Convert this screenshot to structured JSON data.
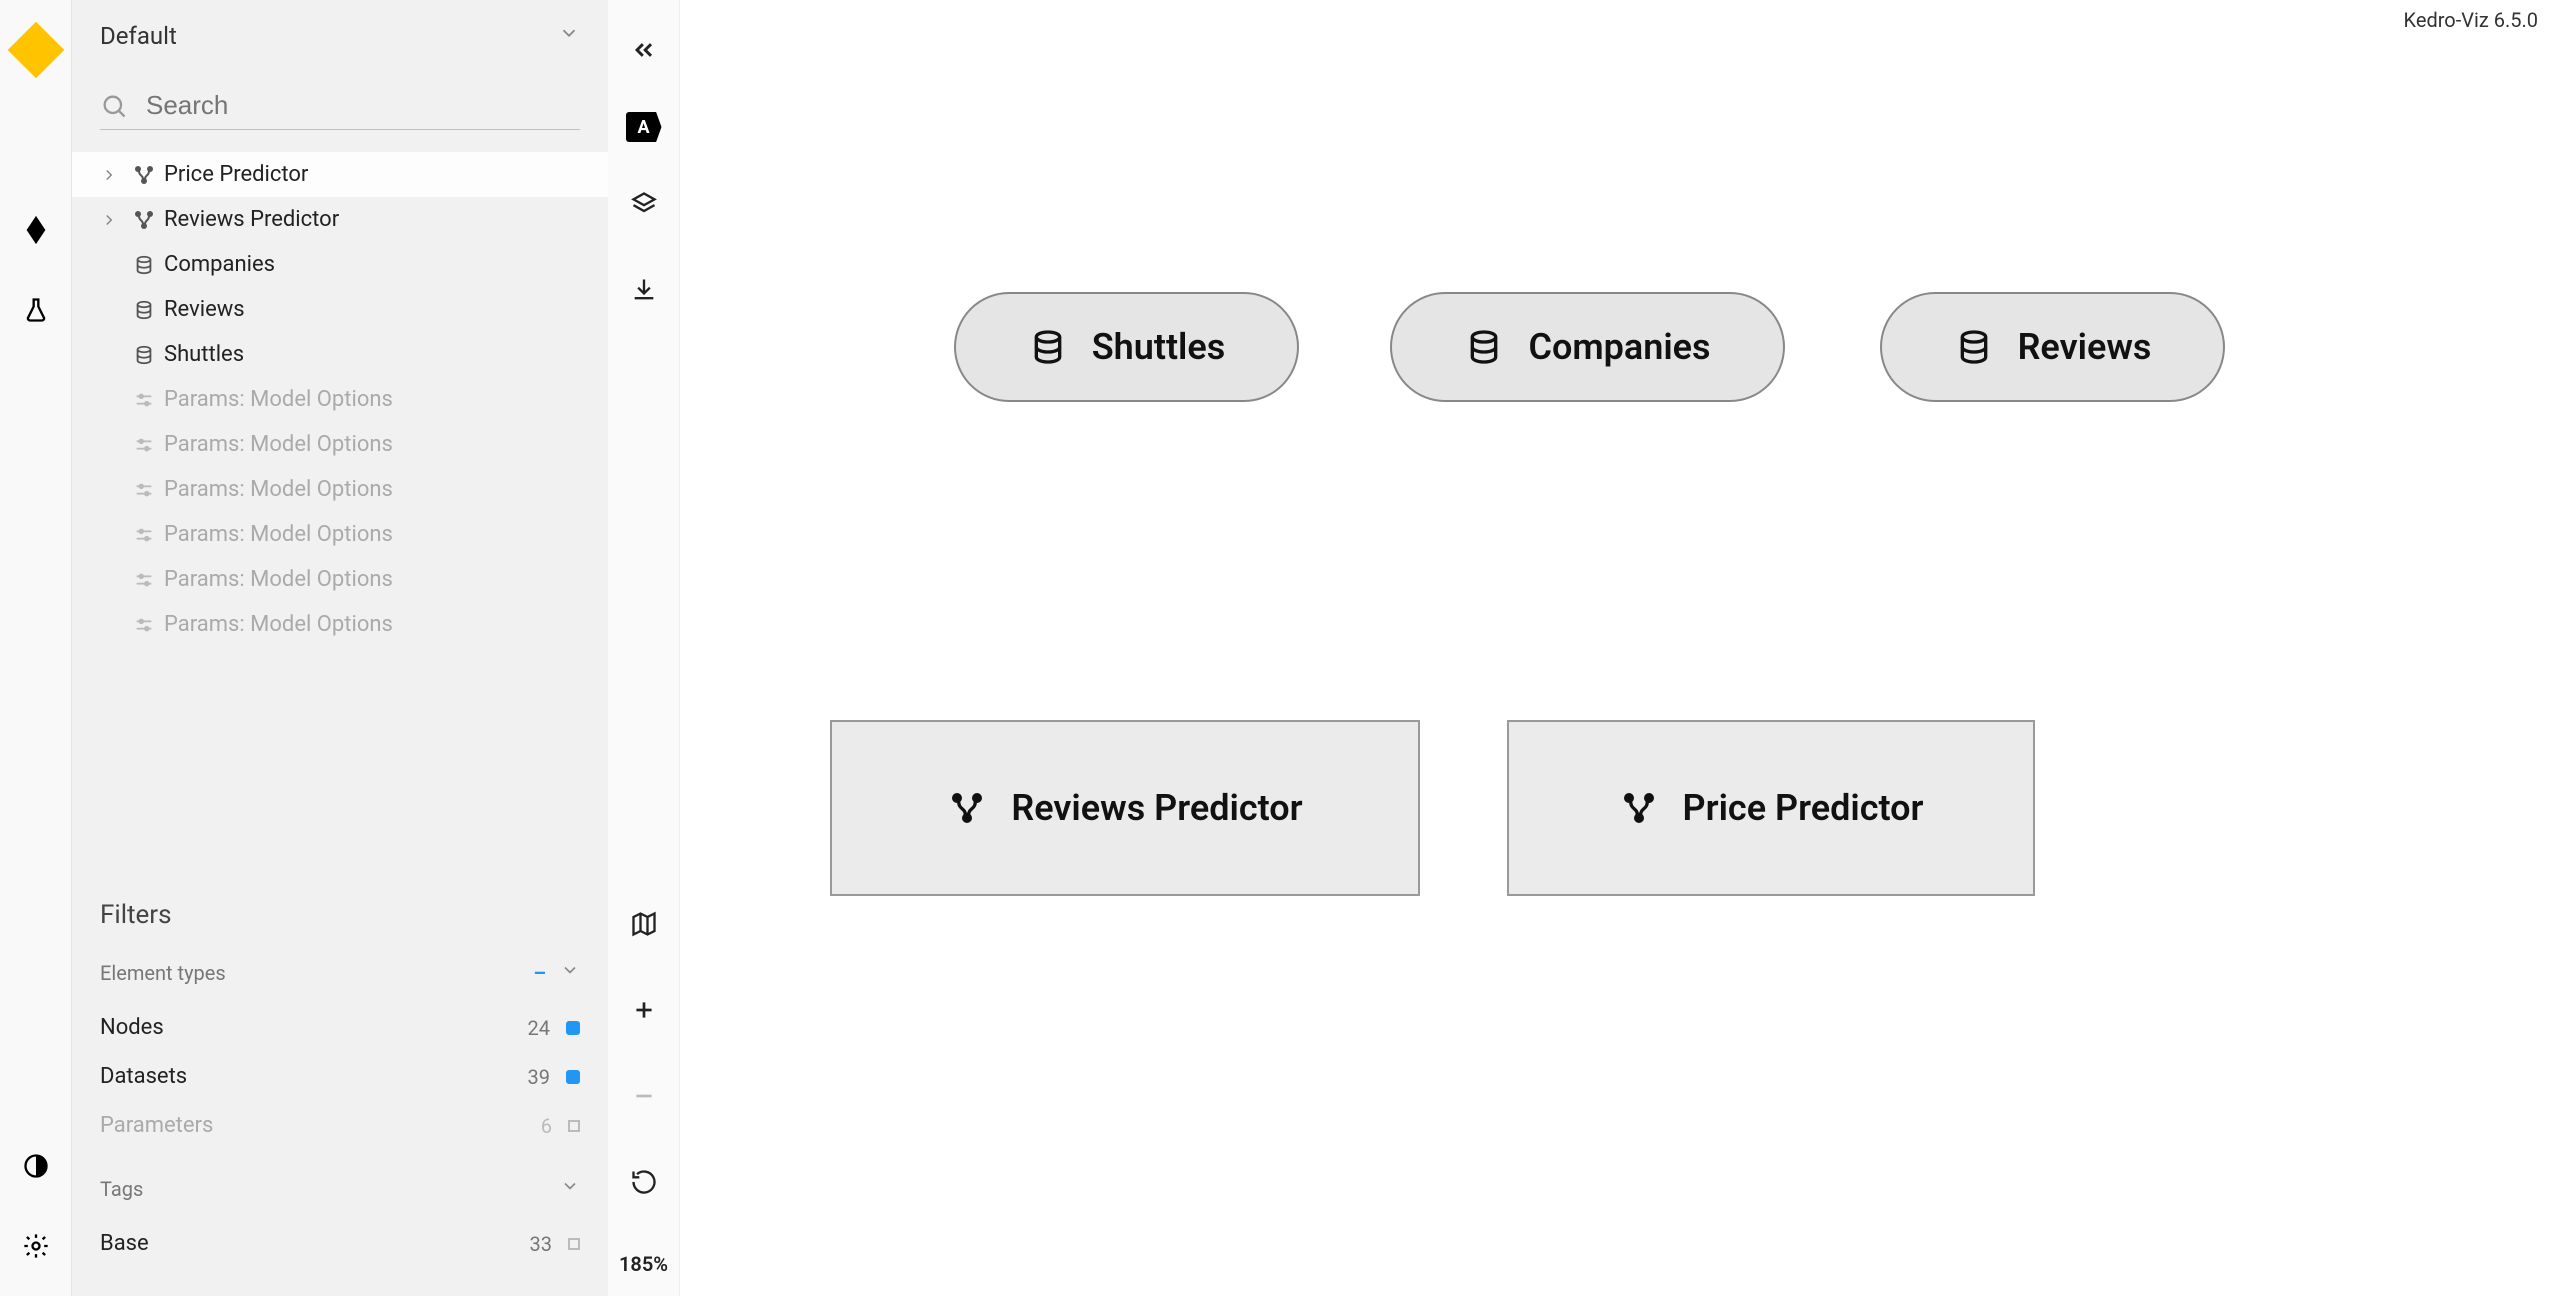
{
  "app_version": "Kedro-Viz 6.5.0",
  "pipeline_selector": {
    "label": "Default"
  },
  "search": {
    "placeholder": "Search"
  },
  "tree": {
    "items": [
      {
        "type": "pipeline",
        "label": "Price Predictor",
        "selected": true,
        "expandable": true
      },
      {
        "type": "pipeline",
        "label": "Reviews Predictor",
        "selected": false,
        "expandable": true
      },
      {
        "type": "data",
        "label": "Companies"
      },
      {
        "type": "data",
        "label": "Reviews"
      },
      {
        "type": "data",
        "label": "Shuttles"
      },
      {
        "type": "params",
        "label": "Params: Model Options",
        "dim": true
      },
      {
        "type": "params",
        "label": "Params: Model Options",
        "dim": true
      },
      {
        "type": "params",
        "label": "Params: Model Options",
        "dim": true
      },
      {
        "type": "params",
        "label": "Params: Model Options",
        "dim": true
      },
      {
        "type": "params",
        "label": "Params: Model Options",
        "dim": true
      },
      {
        "type": "params",
        "label": "Params: Model Options",
        "dim": true
      }
    ]
  },
  "filters": {
    "title": "Filters",
    "element_types_label": "Element types",
    "rows": [
      {
        "label": "Nodes",
        "count": "24",
        "checked": true
      },
      {
        "label": "Datasets",
        "count": "39",
        "checked": true
      },
      {
        "label": "Parameters",
        "count": "6",
        "checked": false,
        "dim": true
      }
    ],
    "tags_label": "Tags",
    "base_label": "Base",
    "base_count": "33"
  },
  "toolbar": {
    "zoom_label": "185%",
    "text_badge": "A"
  },
  "graph": {
    "datasets": [
      {
        "id": "shuttles",
        "label": "Shuttles"
      },
      {
        "id": "companies",
        "label": "Companies"
      },
      {
        "id": "reviews",
        "label": "Reviews"
      }
    ],
    "pipelines": [
      {
        "id": "reviews-predictor",
        "label": "Reviews Predictor"
      },
      {
        "id": "price-predictor",
        "label": "Price Predictor"
      }
    ]
  }
}
